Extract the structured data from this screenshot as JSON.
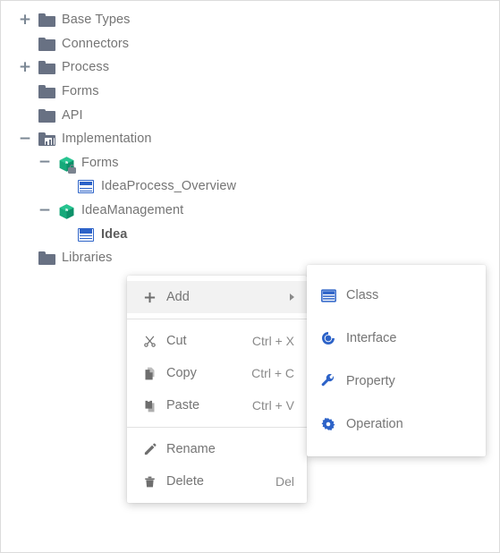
{
  "tree": {
    "items": [
      {
        "label": "Base Types",
        "icon": "folder-icon",
        "toggle": "plus",
        "depth": 0,
        "bold": false
      },
      {
        "label": "Connectors",
        "icon": "folder-icon",
        "toggle": "none",
        "depth": 0,
        "bold": false
      },
      {
        "label": "Process",
        "icon": "folder-icon",
        "toggle": "plus",
        "depth": 0,
        "bold": false
      },
      {
        "label": "Forms",
        "icon": "folder-icon",
        "toggle": "none",
        "depth": 0,
        "bold": false
      },
      {
        "label": "API",
        "icon": "folder-icon",
        "toggle": "none",
        "depth": 0,
        "bold": false
      },
      {
        "label": "Implementation",
        "icon": "implementation-folder-icon",
        "toggle": "minus",
        "depth": 0,
        "bold": false
      },
      {
        "label": "Forms",
        "icon": "locked-package-icon",
        "toggle": "minus",
        "depth": 1,
        "bold": false
      },
      {
        "label": "IdeaProcess_Overview",
        "icon": "class-icon",
        "toggle": "none",
        "depth": 2,
        "bold": false
      },
      {
        "label": "IdeaManagement",
        "icon": "package-icon",
        "toggle": "minus",
        "depth": 1,
        "bold": false
      },
      {
        "label": "Idea",
        "icon": "class-icon",
        "toggle": "none",
        "depth": 2,
        "bold": true
      },
      {
        "label": "Libraries",
        "icon": "folder-icon",
        "toggle": "none",
        "depth": 0,
        "bold": false
      }
    ]
  },
  "context_menu": {
    "groups": [
      {
        "items": [
          {
            "label": "Add",
            "icon": "plus-icon",
            "shortcut": "",
            "submenu": true,
            "highlight": true
          }
        ]
      },
      {
        "items": [
          {
            "label": "Cut",
            "icon": "scissors-icon",
            "shortcut": "Ctrl + X",
            "submenu": false,
            "highlight": false
          },
          {
            "label": "Copy",
            "icon": "copy-icon",
            "shortcut": "Ctrl + C",
            "submenu": false,
            "highlight": false
          },
          {
            "label": "Paste",
            "icon": "paste-icon",
            "shortcut": "Ctrl + V",
            "submenu": false,
            "highlight": false
          }
        ]
      },
      {
        "items": [
          {
            "label": "Rename",
            "icon": "pencil-icon",
            "shortcut": "",
            "submenu": false,
            "highlight": false
          },
          {
            "label": "Delete",
            "icon": "trash-icon",
            "shortcut": "Del",
            "submenu": false,
            "highlight": false
          }
        ]
      }
    ]
  },
  "submenu": {
    "items": [
      {
        "label": "Class",
        "icon": "class-icon"
      },
      {
        "label": "Interface",
        "icon": "interface-icon"
      },
      {
        "label": "Property",
        "icon": "wrench-icon"
      },
      {
        "label": "Operation",
        "icon": "gear-icon"
      }
    ]
  },
  "colors": {
    "text": "#757575",
    "accent_blue": "#2d63c8",
    "package_green": "#16a97a",
    "folder_gray": "#687183",
    "highlight_bg": "#f2f2f2"
  }
}
